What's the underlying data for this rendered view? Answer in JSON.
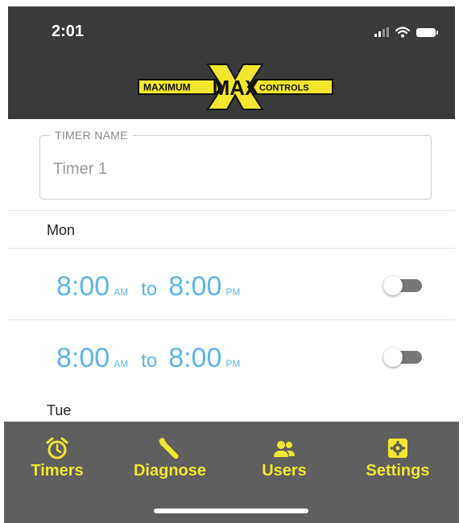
{
  "status_bar": {
    "time": "2:01"
  },
  "logo": {
    "left_text": "MAXIMUM",
    "center_text": "MAX",
    "right_text": "CONTROLS"
  },
  "timer_name": {
    "label": "TIMER NAME",
    "value": "Timer 1"
  },
  "days": [
    {
      "label": "Mon",
      "slots": [
        {
          "start": "8:00",
          "start_period": "AM",
          "to": "to",
          "end": "8:00",
          "end_period": "PM",
          "enabled": false
        },
        {
          "start": "8:00",
          "start_period": "AM",
          "to": "to",
          "end": "8:00",
          "end_period": "PM",
          "enabled": false
        }
      ]
    },
    {
      "label": "Tue"
    }
  ],
  "tabs": [
    {
      "label": "Timers",
      "icon": "alarm-clock-icon"
    },
    {
      "label": "Diagnose",
      "icon": "wrench-icon"
    },
    {
      "label": "Users",
      "icon": "users-icon"
    },
    {
      "label": "Settings",
      "icon": "gear-icon"
    }
  ],
  "colors": {
    "header_bg": "#3a3a3a",
    "tabbar_bg": "#5f5f5f",
    "accent_yellow": "#f2e62e",
    "time_blue": "#5bb5ea"
  }
}
